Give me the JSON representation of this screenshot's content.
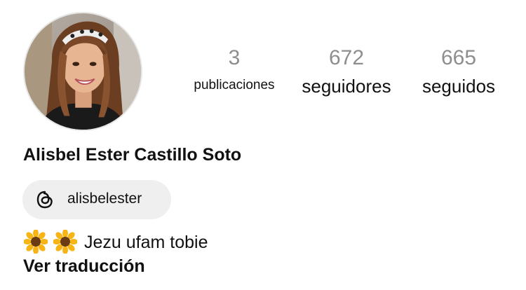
{
  "profile": {
    "avatar_icon": "profile-photo",
    "name": "Alisbel Ester Castillo Soto"
  },
  "stats": {
    "posts": {
      "count": "3",
      "label": "publicaciones"
    },
    "followers": {
      "count": "672",
      "label": "seguidores"
    },
    "following": {
      "count": "665",
      "label": "seguidos"
    }
  },
  "threads": {
    "icon": "threads-icon",
    "handle": "alisbelester"
  },
  "bio": {
    "emoji": "🌻🌻",
    "text": "Jezu ufam tobie"
  },
  "translate_label": "Ver traducción",
  "colors": {
    "text": "#111111",
    "count": "#8e8e8e",
    "pill_bg": "#efefef"
  }
}
